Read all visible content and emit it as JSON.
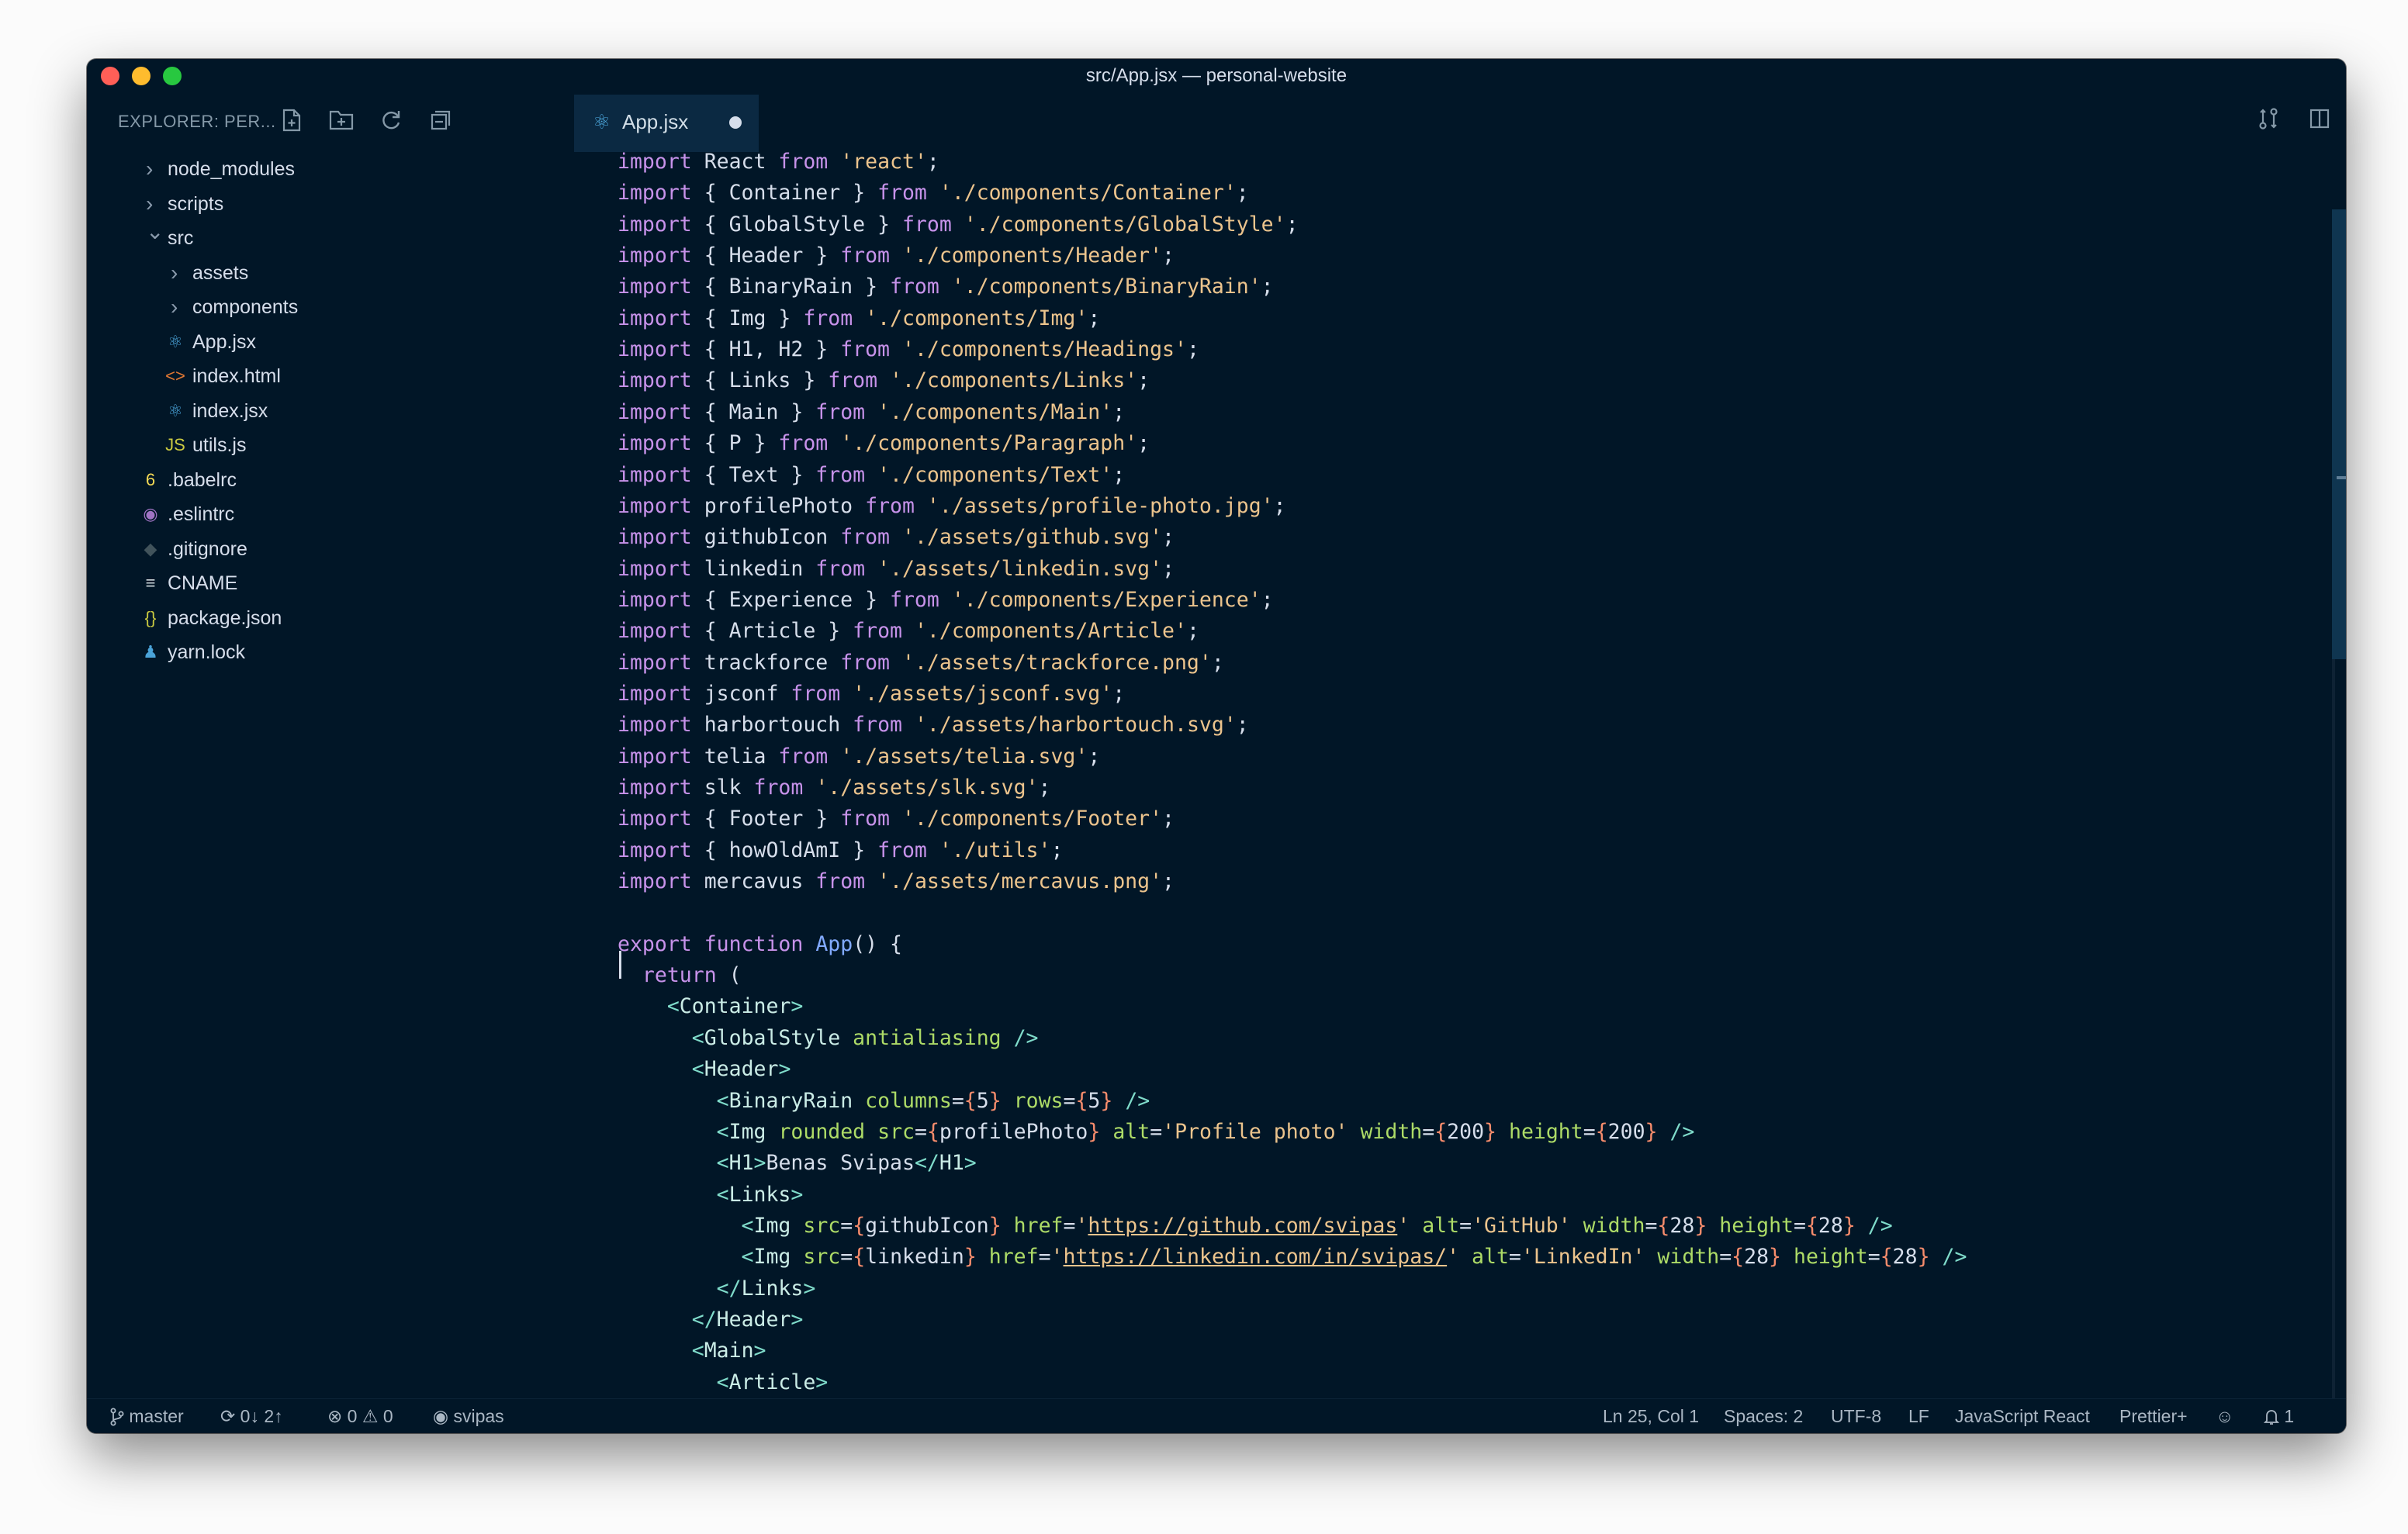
{
  "window": {
    "title": "src/App.jsx — personal-website"
  },
  "sidebar": {
    "label": "EXPLORER: PER...",
    "icons": [
      "new-file-icon",
      "new-folder-icon",
      "refresh-icon",
      "collapse-all-icon"
    ],
    "tree": [
      {
        "label": "node_modules",
        "kind": "folder",
        "depth": 0,
        "expanded": false
      },
      {
        "label": "scripts",
        "kind": "folder",
        "depth": 0,
        "expanded": false
      },
      {
        "label": "src",
        "kind": "folder",
        "depth": 0,
        "expanded": true
      },
      {
        "label": "assets",
        "kind": "folder",
        "depth": 1,
        "expanded": false
      },
      {
        "label": "components",
        "kind": "folder",
        "depth": 1,
        "expanded": false
      },
      {
        "label": "App.jsx",
        "kind": "file",
        "depth": 1,
        "icon": "⚛",
        "icon_color": "#4aa3d8"
      },
      {
        "label": "index.html",
        "kind": "file",
        "depth": 1,
        "icon": "<>",
        "icon_color": "#e37933"
      },
      {
        "label": "index.jsx",
        "kind": "file",
        "depth": 1,
        "icon": "⚛",
        "icon_color": "#4aa3d8"
      },
      {
        "label": "utils.js",
        "kind": "file",
        "depth": 1,
        "icon": "JS",
        "icon_color": "#cbcb41"
      },
      {
        "label": ".babelrc",
        "kind": "file",
        "depth": 0,
        "icon": "6",
        "icon_color": "#f5da55"
      },
      {
        "label": ".eslintrc",
        "kind": "file",
        "depth": 0,
        "icon": "◉",
        "icon_color": "#a074c4"
      },
      {
        "label": ".gitignore",
        "kind": "file",
        "depth": 0,
        "icon": "◆",
        "icon_color": "#41535b"
      },
      {
        "label": "CNAME",
        "kind": "file",
        "depth": 0,
        "icon": "≡",
        "icon_color": "#cfd8dc"
      },
      {
        "label": "package.json",
        "kind": "file",
        "depth": 0,
        "icon": "{}",
        "icon_color": "#cbcb41"
      },
      {
        "label": "yarn.lock",
        "kind": "file",
        "depth": 0,
        "icon": "♟",
        "icon_color": "#4aa3d8"
      }
    ]
  },
  "tabs": [
    {
      "label": "App.jsx",
      "icon": "⚛",
      "modified": true
    }
  ],
  "editor_actions": [
    "source-control-icon",
    "split-editor-icon",
    "more-icon"
  ],
  "colors": {
    "keyword": "#c792ea",
    "string": "#ecc48d",
    "identifier": "#d6deeb",
    "function": "#82aaff",
    "tag": "#caece6",
    "attribute": "#addb67",
    "brace": "#f78c6c",
    "tag-bracket": "#7fdbca",
    "background": "#011627"
  },
  "code": [
    [
      [
        "k",
        "import"
      ],
      [
        "n",
        " React "
      ],
      [
        "k",
        "from"
      ],
      [
        "n",
        " "
      ],
      [
        "s",
        "'react'"
      ],
      [
        "n",
        ";"
      ]
    ],
    [
      [
        "k",
        "import"
      ],
      [
        "n",
        " { Container } "
      ],
      [
        "k",
        "from"
      ],
      [
        "n",
        " "
      ],
      [
        "s",
        "'./components/Container'"
      ],
      [
        "n",
        ";"
      ]
    ],
    [
      [
        "k",
        "import"
      ],
      [
        "n",
        " { GlobalStyle } "
      ],
      [
        "k",
        "from"
      ],
      [
        "n",
        " "
      ],
      [
        "s",
        "'./components/GlobalStyle'"
      ],
      [
        "n",
        ";"
      ]
    ],
    [
      [
        "k",
        "import"
      ],
      [
        "n",
        " { Header } "
      ],
      [
        "k",
        "from"
      ],
      [
        "n",
        " "
      ],
      [
        "s",
        "'./components/Header'"
      ],
      [
        "n",
        ";"
      ]
    ],
    [
      [
        "k",
        "import"
      ],
      [
        "n",
        " { BinaryRain } "
      ],
      [
        "k",
        "from"
      ],
      [
        "n",
        " "
      ],
      [
        "s",
        "'./components/BinaryRain'"
      ],
      [
        "n",
        ";"
      ]
    ],
    [
      [
        "k",
        "import"
      ],
      [
        "n",
        " { Img } "
      ],
      [
        "k",
        "from"
      ],
      [
        "n",
        " "
      ],
      [
        "s",
        "'./components/Img'"
      ],
      [
        "n",
        ";"
      ]
    ],
    [
      [
        "k",
        "import"
      ],
      [
        "n",
        " { H1, H2 } "
      ],
      [
        "k",
        "from"
      ],
      [
        "n",
        " "
      ],
      [
        "s",
        "'./components/Headings'"
      ],
      [
        "n",
        ";"
      ]
    ],
    [
      [
        "k",
        "import"
      ],
      [
        "n",
        " { Links } "
      ],
      [
        "k",
        "from"
      ],
      [
        "n",
        " "
      ],
      [
        "s",
        "'./components/Links'"
      ],
      [
        "n",
        ";"
      ]
    ],
    [
      [
        "k",
        "import"
      ],
      [
        "n",
        " { Main } "
      ],
      [
        "k",
        "from"
      ],
      [
        "n",
        " "
      ],
      [
        "s",
        "'./components/Main'"
      ],
      [
        "n",
        ";"
      ]
    ],
    [
      [
        "k",
        "import"
      ],
      [
        "n",
        " { P } "
      ],
      [
        "k",
        "from"
      ],
      [
        "n",
        " "
      ],
      [
        "s",
        "'./components/Paragraph'"
      ],
      [
        "n",
        ";"
      ]
    ],
    [
      [
        "k",
        "import"
      ],
      [
        "n",
        " { Text } "
      ],
      [
        "k",
        "from"
      ],
      [
        "n",
        " "
      ],
      [
        "s",
        "'./components/Text'"
      ],
      [
        "n",
        ";"
      ]
    ],
    [
      [
        "k",
        "import"
      ],
      [
        "n",
        " profilePhoto "
      ],
      [
        "k",
        "from"
      ],
      [
        "n",
        " "
      ],
      [
        "s",
        "'./assets/profile-photo.jpg'"
      ],
      [
        "n",
        ";"
      ]
    ],
    [
      [
        "k",
        "import"
      ],
      [
        "n",
        " githubIcon "
      ],
      [
        "k",
        "from"
      ],
      [
        "n",
        " "
      ],
      [
        "s",
        "'./assets/github.svg'"
      ],
      [
        "n",
        ";"
      ]
    ],
    [
      [
        "k",
        "import"
      ],
      [
        "n",
        " linkedin "
      ],
      [
        "k",
        "from"
      ],
      [
        "n",
        " "
      ],
      [
        "s",
        "'./assets/linkedin.svg'"
      ],
      [
        "n",
        ";"
      ]
    ],
    [
      [
        "k",
        "import"
      ],
      [
        "n",
        " { Experience } "
      ],
      [
        "k",
        "from"
      ],
      [
        "n",
        " "
      ],
      [
        "s",
        "'./components/Experience'"
      ],
      [
        "n",
        ";"
      ]
    ],
    [
      [
        "k",
        "import"
      ],
      [
        "n",
        " { Article } "
      ],
      [
        "k",
        "from"
      ],
      [
        "n",
        " "
      ],
      [
        "s",
        "'./components/Article'"
      ],
      [
        "n",
        ";"
      ]
    ],
    [
      [
        "k",
        "import"
      ],
      [
        "n",
        " trackforce "
      ],
      [
        "k",
        "from"
      ],
      [
        "n",
        " "
      ],
      [
        "s",
        "'./assets/trackforce.png'"
      ],
      [
        "n",
        ";"
      ]
    ],
    [
      [
        "k",
        "import"
      ],
      [
        "n",
        " jsconf "
      ],
      [
        "k",
        "from"
      ],
      [
        "n",
        " "
      ],
      [
        "s",
        "'./assets/jsconf.svg'"
      ],
      [
        "n",
        ";"
      ]
    ],
    [
      [
        "k",
        "import"
      ],
      [
        "n",
        " harbortouch "
      ],
      [
        "k",
        "from"
      ],
      [
        "n",
        " "
      ],
      [
        "s",
        "'./assets/harbortouch.svg'"
      ],
      [
        "n",
        ";"
      ]
    ],
    [
      [
        "k",
        "import"
      ],
      [
        "n",
        " telia "
      ],
      [
        "k",
        "from"
      ],
      [
        "n",
        " "
      ],
      [
        "s",
        "'./assets/telia.svg'"
      ],
      [
        "n",
        ";"
      ]
    ],
    [
      [
        "k",
        "import"
      ],
      [
        "n",
        " slk "
      ],
      [
        "k",
        "from"
      ],
      [
        "n",
        " "
      ],
      [
        "s",
        "'./assets/slk.svg'"
      ],
      [
        "n",
        ";"
      ]
    ],
    [
      [
        "k",
        "import"
      ],
      [
        "n",
        " { Footer } "
      ],
      [
        "k",
        "from"
      ],
      [
        "n",
        " "
      ],
      [
        "s",
        "'./components/Footer'"
      ],
      [
        "n",
        ";"
      ]
    ],
    [
      [
        "k",
        "import"
      ],
      [
        "n",
        " { howOldAmI } "
      ],
      [
        "k",
        "from"
      ],
      [
        "n",
        " "
      ],
      [
        "s",
        "'./utils'"
      ],
      [
        "n",
        ";"
      ]
    ],
    [
      [
        "k",
        "import"
      ],
      [
        "n",
        " mercavus "
      ],
      [
        "k",
        "from"
      ],
      [
        "n",
        " "
      ],
      [
        "s",
        "'./assets/mercavus.png'"
      ],
      [
        "n",
        ";"
      ]
    ],
    [],
    [
      [
        "k",
        "export"
      ],
      [
        "n",
        " "
      ],
      [
        "k",
        "function"
      ],
      [
        "n",
        " "
      ],
      [
        "f",
        "App"
      ],
      [
        "n",
        "() {"
      ]
    ],
    [
      [
        "n",
        "  "
      ],
      [
        "k",
        "return"
      ],
      [
        "n",
        " ("
      ]
    ],
    [
      [
        "n",
        "    "
      ],
      [
        "tg",
        "<"
      ],
      [
        "t",
        "Container"
      ],
      [
        "tg",
        ">"
      ]
    ],
    [
      [
        "n",
        "      "
      ],
      [
        "tg",
        "<"
      ],
      [
        "t",
        "GlobalStyle"
      ],
      [
        "n",
        " "
      ],
      [
        "a",
        "antialiasing"
      ],
      [
        "n",
        " "
      ],
      [
        "tg",
        "/>"
      ]
    ],
    [
      [
        "n",
        "      "
      ],
      [
        "tg",
        "<"
      ],
      [
        "t",
        "Header"
      ],
      [
        "tg",
        ">"
      ]
    ],
    [
      [
        "n",
        "        "
      ],
      [
        "tg",
        "<"
      ],
      [
        "t",
        "BinaryRain"
      ],
      [
        "n",
        " "
      ],
      [
        "a",
        "columns"
      ],
      [
        "n",
        "="
      ],
      [
        "brk",
        "{"
      ],
      [
        "n",
        "5"
      ],
      [
        "brk",
        "}"
      ],
      [
        "n",
        " "
      ],
      [
        "a",
        "rows"
      ],
      [
        "n",
        "="
      ],
      [
        "brk",
        "{"
      ],
      [
        "n",
        "5"
      ],
      [
        "brk",
        "}"
      ],
      [
        "n",
        " "
      ],
      [
        "tg",
        "/>"
      ]
    ],
    [
      [
        "n",
        "        "
      ],
      [
        "tg",
        "<"
      ],
      [
        "t",
        "Img"
      ],
      [
        "n",
        " "
      ],
      [
        "a",
        "rounded"
      ],
      [
        "n",
        " "
      ],
      [
        "a",
        "src"
      ],
      [
        "n",
        "="
      ],
      [
        "brk",
        "{"
      ],
      [
        "n",
        "profilePhoto"
      ],
      [
        "brk",
        "}"
      ],
      [
        "n",
        " "
      ],
      [
        "a",
        "alt"
      ],
      [
        "n",
        "="
      ],
      [
        "s",
        "'Profile photo'"
      ],
      [
        "n",
        " "
      ],
      [
        "a",
        "width"
      ],
      [
        "n",
        "="
      ],
      [
        "brk",
        "{"
      ],
      [
        "n",
        "200"
      ],
      [
        "brk",
        "}"
      ],
      [
        "n",
        " "
      ],
      [
        "a",
        "height"
      ],
      [
        "n",
        "="
      ],
      [
        "brk",
        "{"
      ],
      [
        "n",
        "200"
      ],
      [
        "brk",
        "}"
      ],
      [
        "n",
        " "
      ],
      [
        "tg",
        "/>"
      ]
    ],
    [
      [
        "n",
        "        "
      ],
      [
        "tg",
        "<"
      ],
      [
        "t",
        "H1"
      ],
      [
        "tg",
        ">"
      ],
      [
        "n",
        "Benas Svipas"
      ],
      [
        "tg",
        "</"
      ],
      [
        "t",
        "H1"
      ],
      [
        "tg",
        ">"
      ]
    ],
    [
      [
        "n",
        "        "
      ],
      [
        "tg",
        "<"
      ],
      [
        "t",
        "Links"
      ],
      [
        "tg",
        ">"
      ]
    ],
    [
      [
        "n",
        "          "
      ],
      [
        "tg",
        "<"
      ],
      [
        "t",
        "Img"
      ],
      [
        "n",
        " "
      ],
      [
        "a",
        "src"
      ],
      [
        "n",
        "="
      ],
      [
        "brk",
        "{"
      ],
      [
        "n",
        "githubIcon"
      ],
      [
        "brk",
        "}"
      ],
      [
        "n",
        " "
      ],
      [
        "a",
        "href"
      ],
      [
        "n",
        "="
      ],
      [
        "s",
        "'"
      ],
      [
        "su",
        "https://github.com/svipas"
      ],
      [
        "s",
        "'"
      ],
      [
        "n",
        " "
      ],
      [
        "a",
        "alt"
      ],
      [
        "n",
        "="
      ],
      [
        "s",
        "'GitHub'"
      ],
      [
        "n",
        " "
      ],
      [
        "a",
        "width"
      ],
      [
        "n",
        "="
      ],
      [
        "brk",
        "{"
      ],
      [
        "n",
        "28"
      ],
      [
        "brk",
        "}"
      ],
      [
        "n",
        " "
      ],
      [
        "a",
        "height"
      ],
      [
        "n",
        "="
      ],
      [
        "brk",
        "{"
      ],
      [
        "n",
        "28"
      ],
      [
        "brk",
        "}"
      ],
      [
        "n",
        " "
      ],
      [
        "tg",
        "/>"
      ]
    ],
    [
      [
        "n",
        "          "
      ],
      [
        "tg",
        "<"
      ],
      [
        "t",
        "Img"
      ],
      [
        "n",
        " "
      ],
      [
        "a",
        "src"
      ],
      [
        "n",
        "="
      ],
      [
        "brk",
        "{"
      ],
      [
        "n",
        "linkedin"
      ],
      [
        "brk",
        "}"
      ],
      [
        "n",
        " "
      ],
      [
        "a",
        "href"
      ],
      [
        "n",
        "="
      ],
      [
        "s",
        "'"
      ],
      [
        "su",
        "https://linkedin.com/in/svipas/"
      ],
      [
        "s",
        "'"
      ],
      [
        "n",
        " "
      ],
      [
        "a",
        "alt"
      ],
      [
        "n",
        "="
      ],
      [
        "s",
        "'LinkedIn'"
      ],
      [
        "n",
        " "
      ],
      [
        "a",
        "width"
      ],
      [
        "n",
        "="
      ],
      [
        "brk",
        "{"
      ],
      [
        "n",
        "28"
      ],
      [
        "brk",
        "}"
      ],
      [
        "n",
        " "
      ],
      [
        "a",
        "height"
      ],
      [
        "n",
        "="
      ],
      [
        "brk",
        "{"
      ],
      [
        "n",
        "28"
      ],
      [
        "brk",
        "}"
      ],
      [
        "n",
        " "
      ],
      [
        "tg",
        "/>"
      ]
    ],
    [
      [
        "n",
        "        "
      ],
      [
        "tg",
        "</"
      ],
      [
        "t",
        "Links"
      ],
      [
        "tg",
        ">"
      ]
    ],
    [
      [
        "n",
        "      "
      ],
      [
        "tg",
        "</"
      ],
      [
        "t",
        "Header"
      ],
      [
        "tg",
        ">"
      ]
    ],
    [
      [
        "n",
        "      "
      ],
      [
        "tg",
        "<"
      ],
      [
        "t",
        "Main"
      ],
      [
        "tg",
        ">"
      ]
    ],
    [
      [
        "n",
        "        "
      ],
      [
        "tg",
        "<"
      ],
      [
        "t",
        "Article"
      ],
      [
        "tg",
        ">"
      ]
    ]
  ],
  "status": {
    "branch": "master",
    "sync": "0↓ 2↑",
    "errors": "0",
    "warnings": "0",
    "account": "svipas",
    "position": "Ln 25, Col 1",
    "spaces": "Spaces: 2",
    "encoding": "UTF-8",
    "eol": "LF",
    "language": "JavaScript React",
    "formatter": "Prettier+",
    "notifications": "1"
  }
}
